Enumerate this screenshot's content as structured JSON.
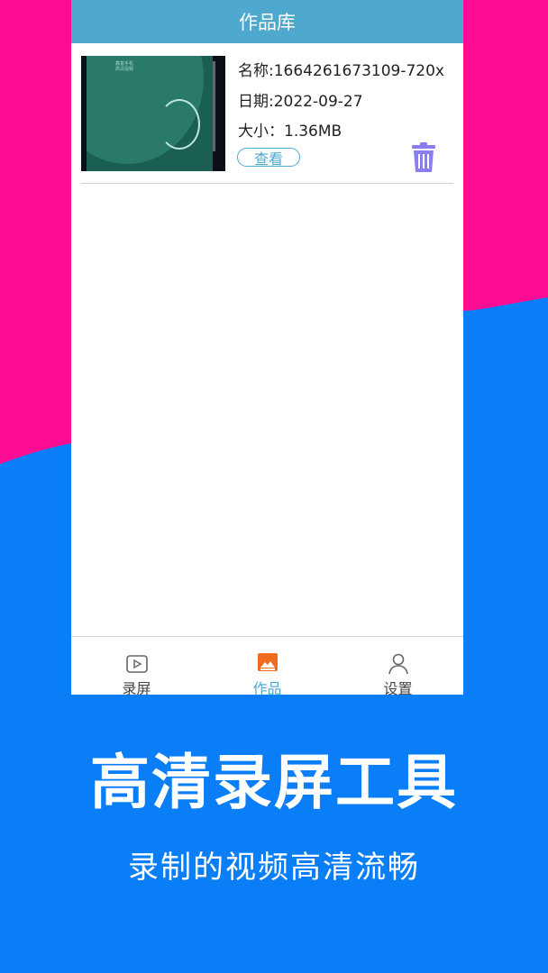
{
  "titlebar": {
    "title": "作品库"
  },
  "works": [
    {
      "thumbnail_caption": "鑫富手机\n高清视频",
      "name_label": "名称:",
      "name_value": "1664261673109-720x",
      "date_label": "日期:",
      "date_value": "2022-09-27",
      "size_label": "大小：",
      "size_value": "1.36MB",
      "view_label": "查看",
      "delete_icon": "trash-icon"
    }
  ],
  "tabbar": {
    "items": [
      {
        "label": "录屏",
        "icon": "play-video-icon",
        "active": false
      },
      {
        "label": "作品",
        "icon": "image-gallery-icon",
        "active": true
      },
      {
        "label": "设置",
        "icon": "user-icon",
        "active": false
      }
    ]
  },
  "promo": {
    "headline": "高清录屏工具",
    "subheadline": "录制的视频高清流畅"
  },
  "colors": {
    "pink": "#ff0c94",
    "blue": "#0a7ef6",
    "header": "#4fa9cf",
    "trash": "#8a7ff0",
    "active_tab_icon": "#f06b1e"
  }
}
